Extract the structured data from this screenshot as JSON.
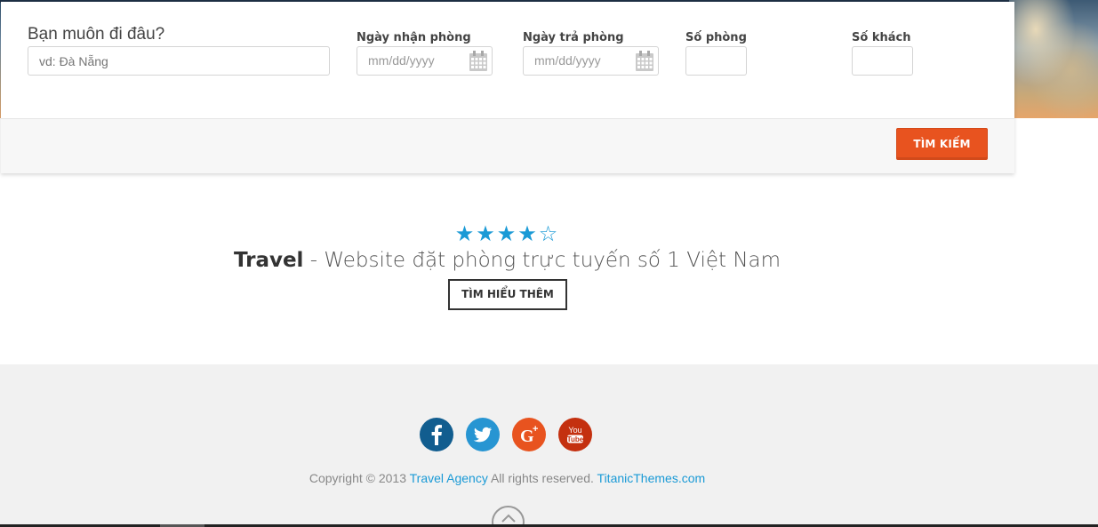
{
  "search": {
    "destination_label": "Bạn muôn đi đâu?",
    "destination_placeholder": "vd: Đà Nẵng",
    "checkin_label": "Ngày nhận phòng",
    "checkin_placeholder": "mm/dd/yyyy",
    "checkout_label": "Ngày trả phòng",
    "checkout_placeholder": "mm/dd/yyyy",
    "rooms_label": "Số phòng",
    "rooms_value": "",
    "guests_label": "Số khách",
    "guests_value": "",
    "submit_label": "TÌM KIẾM",
    "accent_color": "#e8531f"
  },
  "promo": {
    "rating": 4,
    "max_rating": 5,
    "stars_text": "★★★★☆",
    "brand": "Travel",
    "tagline": " - Website đặt phòng trực tuyến số 1 Việt Nam",
    "learn_more_label": "TÌM HIỂU THÊM"
  },
  "footer": {
    "social": [
      {
        "name": "facebook-icon",
        "color": "#115d8f"
      },
      {
        "name": "twitter-icon",
        "color": "#2795d2"
      },
      {
        "name": "google-plus-icon",
        "color": "#e8531f"
      },
      {
        "name": "youtube-icon",
        "color": "#c4300f"
      }
    ],
    "copyright_prefix": "Copyright © 2013",
    "agency_link": "Travel Agency",
    "rights_text": "All rights reserved.",
    "themes_link": "TitanicThemes.com",
    "link_color": "#1a9ad6"
  }
}
